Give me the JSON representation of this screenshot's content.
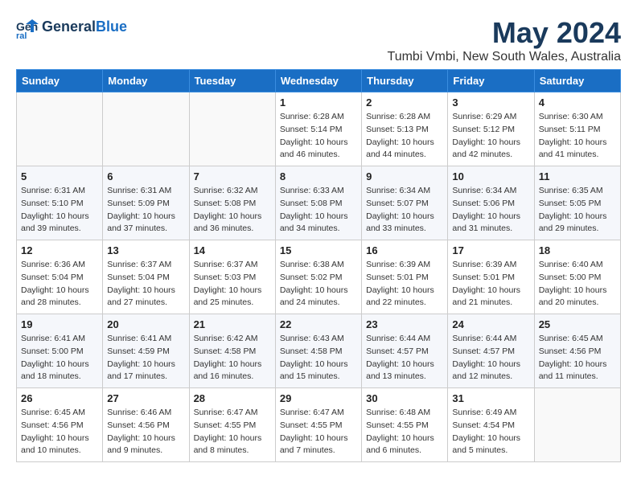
{
  "header": {
    "logo_line1": "General",
    "logo_line2": "Blue",
    "title": "May 2024",
    "subtitle": "Tumbi Vmbi, New South Wales, Australia"
  },
  "days_of_week": [
    "Sunday",
    "Monday",
    "Tuesday",
    "Wednesday",
    "Thursday",
    "Friday",
    "Saturday"
  ],
  "weeks": [
    [
      {
        "day": "",
        "info": ""
      },
      {
        "day": "",
        "info": ""
      },
      {
        "day": "",
        "info": ""
      },
      {
        "day": "1",
        "info": "Sunrise: 6:28 AM\nSunset: 5:14 PM\nDaylight: 10 hours\nand 46 minutes."
      },
      {
        "day": "2",
        "info": "Sunrise: 6:28 AM\nSunset: 5:13 PM\nDaylight: 10 hours\nand 44 minutes."
      },
      {
        "day": "3",
        "info": "Sunrise: 6:29 AM\nSunset: 5:12 PM\nDaylight: 10 hours\nand 42 minutes."
      },
      {
        "day": "4",
        "info": "Sunrise: 6:30 AM\nSunset: 5:11 PM\nDaylight: 10 hours\nand 41 minutes."
      }
    ],
    [
      {
        "day": "5",
        "info": "Sunrise: 6:31 AM\nSunset: 5:10 PM\nDaylight: 10 hours\nand 39 minutes."
      },
      {
        "day": "6",
        "info": "Sunrise: 6:31 AM\nSunset: 5:09 PM\nDaylight: 10 hours\nand 37 minutes."
      },
      {
        "day": "7",
        "info": "Sunrise: 6:32 AM\nSunset: 5:08 PM\nDaylight: 10 hours\nand 36 minutes."
      },
      {
        "day": "8",
        "info": "Sunrise: 6:33 AM\nSunset: 5:08 PM\nDaylight: 10 hours\nand 34 minutes."
      },
      {
        "day": "9",
        "info": "Sunrise: 6:34 AM\nSunset: 5:07 PM\nDaylight: 10 hours\nand 33 minutes."
      },
      {
        "day": "10",
        "info": "Sunrise: 6:34 AM\nSunset: 5:06 PM\nDaylight: 10 hours\nand 31 minutes."
      },
      {
        "day": "11",
        "info": "Sunrise: 6:35 AM\nSunset: 5:05 PM\nDaylight: 10 hours\nand 29 minutes."
      }
    ],
    [
      {
        "day": "12",
        "info": "Sunrise: 6:36 AM\nSunset: 5:04 PM\nDaylight: 10 hours\nand 28 minutes."
      },
      {
        "day": "13",
        "info": "Sunrise: 6:37 AM\nSunset: 5:04 PM\nDaylight: 10 hours\nand 27 minutes."
      },
      {
        "day": "14",
        "info": "Sunrise: 6:37 AM\nSunset: 5:03 PM\nDaylight: 10 hours\nand 25 minutes."
      },
      {
        "day": "15",
        "info": "Sunrise: 6:38 AM\nSunset: 5:02 PM\nDaylight: 10 hours\nand 24 minutes."
      },
      {
        "day": "16",
        "info": "Sunrise: 6:39 AM\nSunset: 5:01 PM\nDaylight: 10 hours\nand 22 minutes."
      },
      {
        "day": "17",
        "info": "Sunrise: 6:39 AM\nSunset: 5:01 PM\nDaylight: 10 hours\nand 21 minutes."
      },
      {
        "day": "18",
        "info": "Sunrise: 6:40 AM\nSunset: 5:00 PM\nDaylight: 10 hours\nand 20 minutes."
      }
    ],
    [
      {
        "day": "19",
        "info": "Sunrise: 6:41 AM\nSunset: 5:00 PM\nDaylight: 10 hours\nand 18 minutes."
      },
      {
        "day": "20",
        "info": "Sunrise: 6:41 AM\nSunset: 4:59 PM\nDaylight: 10 hours\nand 17 minutes."
      },
      {
        "day": "21",
        "info": "Sunrise: 6:42 AM\nSunset: 4:58 PM\nDaylight: 10 hours\nand 16 minutes."
      },
      {
        "day": "22",
        "info": "Sunrise: 6:43 AM\nSunset: 4:58 PM\nDaylight: 10 hours\nand 15 minutes."
      },
      {
        "day": "23",
        "info": "Sunrise: 6:44 AM\nSunset: 4:57 PM\nDaylight: 10 hours\nand 13 minutes."
      },
      {
        "day": "24",
        "info": "Sunrise: 6:44 AM\nSunset: 4:57 PM\nDaylight: 10 hours\nand 12 minutes."
      },
      {
        "day": "25",
        "info": "Sunrise: 6:45 AM\nSunset: 4:56 PM\nDaylight: 10 hours\nand 11 minutes."
      }
    ],
    [
      {
        "day": "26",
        "info": "Sunrise: 6:45 AM\nSunset: 4:56 PM\nDaylight: 10 hours\nand 10 minutes."
      },
      {
        "day": "27",
        "info": "Sunrise: 6:46 AM\nSunset: 4:56 PM\nDaylight: 10 hours\nand 9 minutes."
      },
      {
        "day": "28",
        "info": "Sunrise: 6:47 AM\nSunset: 4:55 PM\nDaylight: 10 hours\nand 8 minutes."
      },
      {
        "day": "29",
        "info": "Sunrise: 6:47 AM\nSunset: 4:55 PM\nDaylight: 10 hours\nand 7 minutes."
      },
      {
        "day": "30",
        "info": "Sunrise: 6:48 AM\nSunset: 4:55 PM\nDaylight: 10 hours\nand 6 minutes."
      },
      {
        "day": "31",
        "info": "Sunrise: 6:49 AM\nSunset: 4:54 PM\nDaylight: 10 hours\nand 5 minutes."
      },
      {
        "day": "",
        "info": ""
      }
    ]
  ]
}
